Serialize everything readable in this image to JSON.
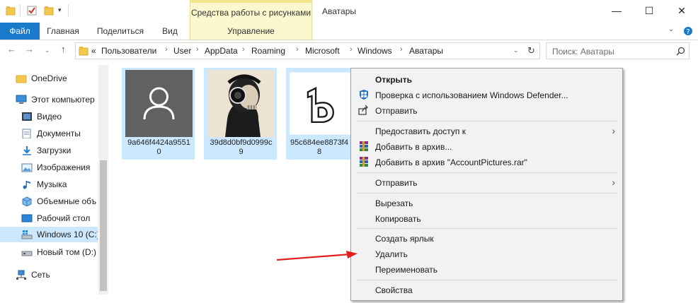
{
  "window": {
    "title": "Аватары",
    "context_tab_label": "Средства работы с рисунками",
    "minimize": "—",
    "maximize": "☐",
    "close": "✕"
  },
  "ribbon": {
    "file": "Файл",
    "home": "Главная",
    "share": "Поделиться",
    "view": "Вид",
    "manage": "Управление"
  },
  "address": {
    "prefix": "«",
    "crumbs": [
      "Пользователи",
      "User",
      "AppData",
      "Roaming",
      "Microsoft",
      "Windows",
      "Аватары"
    ],
    "search_placeholder": "Поиск: Аватары"
  },
  "navpane": {
    "items": [
      {
        "label": "OneDrive",
        "icon": "folder-icon"
      },
      {
        "label": "Этот компьютер",
        "icon": "computer-icon"
      },
      {
        "label": "Видео",
        "icon": "video-icon"
      },
      {
        "label": "Документы",
        "icon": "documents-icon"
      },
      {
        "label": "Загрузки",
        "icon": "downloads-icon"
      },
      {
        "label": "Изображения",
        "icon": "pictures-icon"
      },
      {
        "label": "Музыка",
        "icon": "music-icon"
      },
      {
        "label": "Объемные объ",
        "icon": "3d-objects-icon"
      },
      {
        "label": "Рабочий стол",
        "icon": "desktop-icon"
      },
      {
        "label": "Windows 10 (C:)",
        "icon": "drive-icon"
      },
      {
        "label": "Новый том (D:)",
        "icon": "drive-icon"
      },
      {
        "label": "Сеть",
        "icon": "network-icon"
      }
    ]
  },
  "files": [
    {
      "name_line1": "9a646f4424a9551",
      "name_line2": "0"
    },
    {
      "name_line1": "39d8d0bf9d0999c",
      "name_line2": "9"
    },
    {
      "name_line1": "95c684ee8873f4",
      "name_line2": "8"
    }
  ],
  "context_menu": {
    "open": "Открыть",
    "defender": "Проверка с использованием Windows Defender...",
    "send": "Отправить",
    "share_access": "Предоставить доступ к",
    "add_archive": "Добавить в архив...",
    "add_archive_rar": "Добавить в архив \"AccountPictures.rar\"",
    "send_to": "Отправить",
    "cut": "Вырезать",
    "copy": "Копировать",
    "create_shortcut": "Создать ярлык",
    "delete": "Удалить",
    "rename": "Переименовать",
    "properties": "Свойства"
  },
  "colors": {
    "accent": "#1979ca",
    "selection": "#cce8ff",
    "context_tab": "#fbf7cf",
    "annotation_arrow": "#e02020"
  }
}
